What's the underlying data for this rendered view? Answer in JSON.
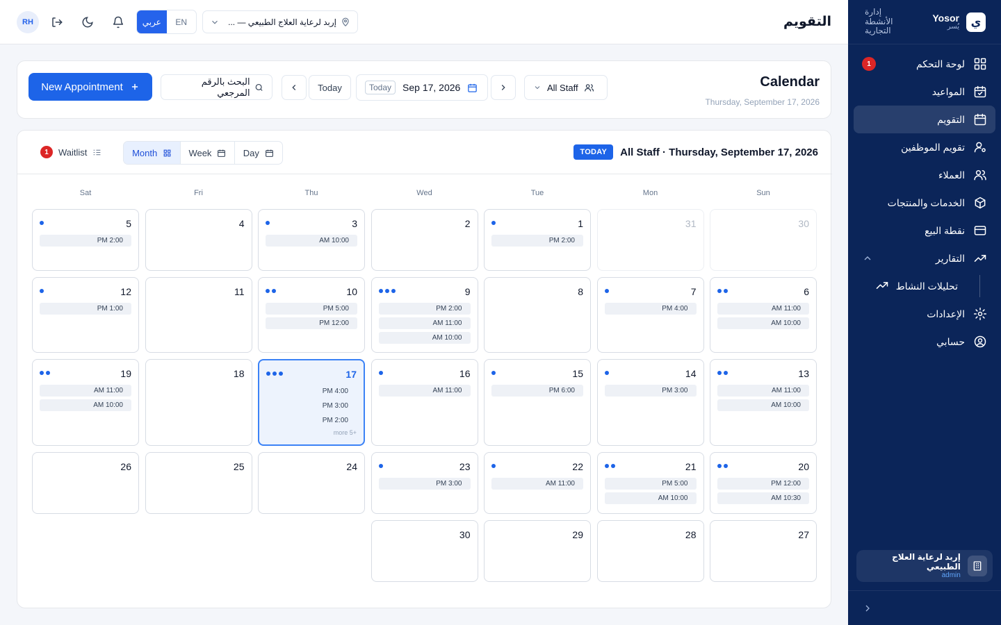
{
  "brand": {
    "name_en": "Yosor",
    "name_ar": "يُسر",
    "subtitle": "إدارة الأنشطة التجارية",
    "logo_glyph": "ي"
  },
  "sidebar": {
    "items": [
      {
        "label": "لوحة التحكم",
        "icon": "dashboard-icon",
        "badge": "1"
      },
      {
        "label": "المواعيد",
        "icon": "calendar-check-icon"
      },
      {
        "label": "التقويم",
        "icon": "calendar-icon",
        "active": true
      },
      {
        "label": "تقويم الموظفين",
        "icon": "user-cog-icon"
      },
      {
        "label": "العملاء",
        "icon": "users-icon"
      },
      {
        "label": "الخدمات والمنتجات",
        "icon": "package-icon"
      },
      {
        "label": "نقطة البيع",
        "icon": "credit-card-icon"
      },
      {
        "label": "التقارير",
        "icon": "trending-up-icon",
        "expanded": true
      },
      {
        "label": "تحليلات النشاط",
        "icon": "trending-up-icon",
        "sub": true
      },
      {
        "label": "الإعدادات",
        "icon": "gear-icon"
      },
      {
        "label": "حسابي",
        "icon": "user-circle-icon"
      }
    ],
    "org": {
      "name": "إربد لرعاية العلاج الطبيعي",
      "role": "admin"
    }
  },
  "topbar": {
    "title": "التقويم",
    "avatar": "RH",
    "lang_ar": "عربي",
    "lang_en": "EN",
    "location": "إربد لرعاية العلاج الطبيعي — ..."
  },
  "header": {
    "title": "Calendar",
    "subtitle": "Thursday, September 17, 2026",
    "new_appointment": "New Appointment",
    "search_placeholder": "البحث بالرقم المرجعي",
    "today": "Today",
    "date_pill": "Today",
    "date": "Sep 17, 2026",
    "staff": "All Staff"
  },
  "calendar": {
    "waitlist_label": "Waitlist",
    "waitlist_count": "1",
    "views": [
      "Month",
      "Week",
      "Day"
    ],
    "active_view": "Month",
    "today_badge": "TODAY",
    "title": "All Staff · Thursday, September 17, 2026",
    "weekdays": [
      "Sun",
      "Mon",
      "Tue",
      "Wed",
      "Thu",
      "Fri",
      "Sat"
    ],
    "weeks": [
      [
        {
          "day": "30",
          "muted": true,
          "appts": []
        },
        {
          "day": "31",
          "muted": true,
          "appts": []
        },
        {
          "day": "1",
          "appts": [
            "PM 2:00"
          ]
        },
        {
          "day": "2",
          "appts": []
        },
        {
          "day": "3",
          "appts": [
            "AM 10:00"
          ]
        },
        {
          "day": "4",
          "appts": []
        },
        {
          "day": "5",
          "appts": [
            "PM 2:00"
          ]
        }
      ],
      [
        {
          "day": "6",
          "appts": [
            "AM 11:00",
            "AM 10:00"
          ]
        },
        {
          "day": "7",
          "appts": [
            "PM 4:00"
          ]
        },
        {
          "day": "8",
          "appts": []
        },
        {
          "day": "9",
          "appts": [
            "PM 2:00",
            "AM 11:00",
            "AM 10:00"
          ]
        },
        {
          "day": "10",
          "appts": [
            "PM 5:00",
            "PM 12:00"
          ]
        },
        {
          "day": "11",
          "appts": []
        },
        {
          "day": "12",
          "appts": [
            "PM 1:00"
          ]
        }
      ],
      [
        {
          "day": "13",
          "appts": [
            "AM 11:00",
            "AM 10:00"
          ]
        },
        {
          "day": "14",
          "appts": [
            "PM 3:00"
          ]
        },
        {
          "day": "15",
          "appts": [
            "PM 6:00"
          ]
        },
        {
          "day": "16",
          "appts": [
            "AM 11:00"
          ]
        },
        {
          "day": "17",
          "today": true,
          "dots": 3,
          "appts": [
            "PM 4:00",
            "PM 3:00",
            "PM 2:00"
          ],
          "more": "more 5+"
        },
        {
          "day": "18",
          "appts": []
        },
        {
          "day": "19",
          "appts": [
            "AM 11:00",
            "AM 10:00"
          ]
        }
      ],
      [
        {
          "day": "20",
          "appts": [
            "PM 12:00",
            "AM 10:30"
          ]
        },
        {
          "day": "21",
          "appts": [
            "PM 5:00",
            "AM 10:00"
          ]
        },
        {
          "day": "22",
          "appts": [
            "AM 11:00"
          ]
        },
        {
          "day": "23",
          "appts": [
            "PM 3:00"
          ]
        },
        {
          "day": "24",
          "appts": []
        },
        {
          "day": "25",
          "appts": []
        },
        {
          "day": "26",
          "appts": []
        }
      ],
      [
        {
          "day": "27",
          "appts": []
        },
        {
          "day": "28",
          "appts": []
        },
        {
          "day": "29",
          "appts": []
        },
        {
          "day": "30",
          "appts": []
        }
      ]
    ]
  },
  "colors": {
    "primary": "#1d64e8",
    "sidebar": "#0b2559",
    "badge": "#dc2626",
    "today_bg": "#edf3fd"
  }
}
